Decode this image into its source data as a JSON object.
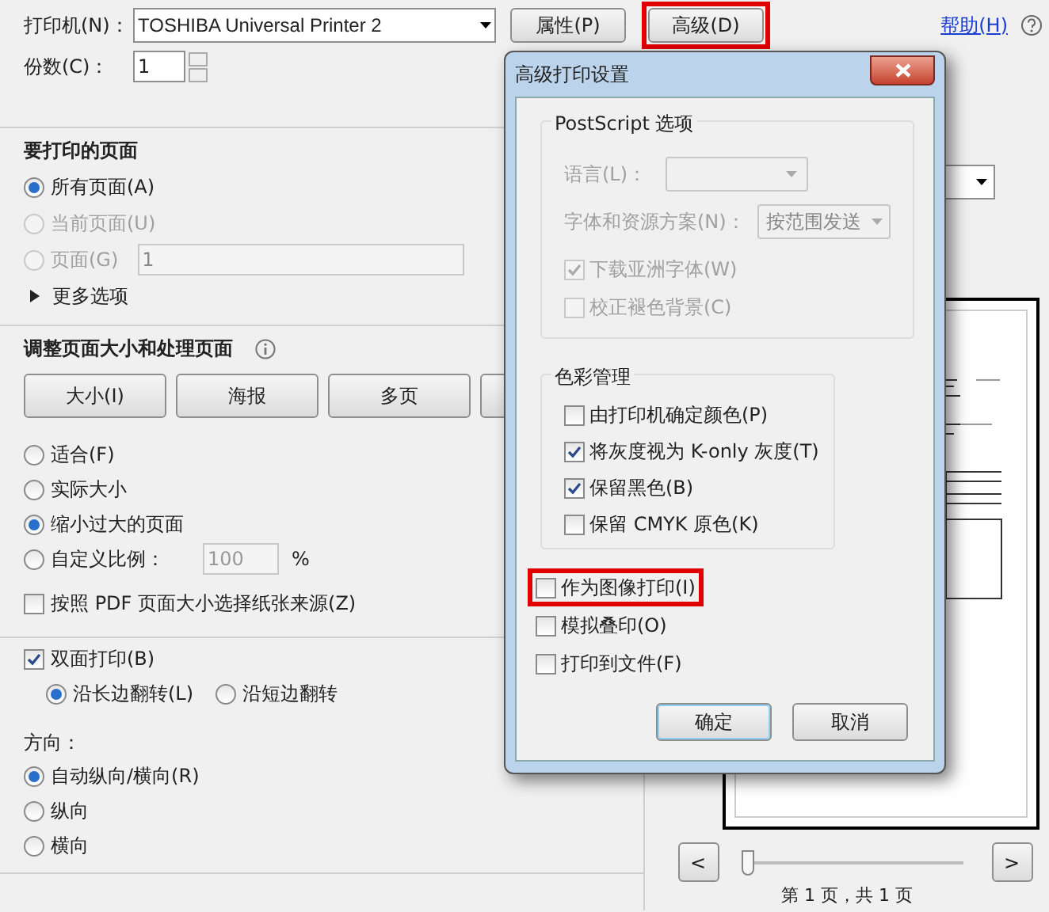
{
  "printer": {
    "label": "打印机(N)：",
    "value": "TOSHIBA Universal Printer 2"
  },
  "top_buttons": [
    {
      "label": "属性(P)",
      "highlighted": false
    },
    {
      "label": "高级(D)",
      "highlighted": true
    }
  ],
  "help_link": "帮助(H)",
  "copies": {
    "label": "份数(C)：",
    "value": "1"
  },
  "pages_section": {
    "title": "要打印的页面",
    "options": [
      {
        "label": "所有页面(A)",
        "selected": true,
        "disabled": false
      },
      {
        "label": "当前页面(U)",
        "selected": false,
        "disabled": true
      },
      {
        "label": "页面(G)",
        "selected": false,
        "disabled": true,
        "field_value": "1"
      }
    ],
    "more": "更多选项"
  },
  "sizing_section": {
    "title": "调整页面大小和处理页面",
    "buttons": [
      "大小(I)",
      "海报",
      "多页"
    ],
    "options": [
      {
        "label": "适合(F)",
        "selected": false
      },
      {
        "label": "实际大小",
        "selected": false
      },
      {
        "label": "缩小过大的页面",
        "selected": true
      },
      {
        "label": "自定义比例：",
        "selected": false,
        "field_value": "100",
        "unit": "%"
      }
    ],
    "paper_source": {
      "label": "按照 PDF 页面大小选择纸张来源(Z)",
      "checked": false
    }
  },
  "duplex": {
    "label": "双面打印(B)",
    "checked": true,
    "options": [
      {
        "label": "沿长边翻转(L)",
        "selected": true
      },
      {
        "label": "沿短边翻转",
        "selected": false
      }
    ]
  },
  "orientation": {
    "title": "方向：",
    "options": [
      {
        "label": "自动纵向/横向(R)",
        "selected": true
      },
      {
        "label": "纵向",
        "selected": false
      },
      {
        "label": "横向",
        "selected": false
      }
    ]
  },
  "preview": {
    "prev": "<",
    "next": ">",
    "slider": {
      "level": 0
    },
    "page_info": "第 1 页，共 1 页"
  },
  "dialog": {
    "title": "高级打印设置",
    "postscript": {
      "title": "PostScript 选项",
      "language_label": "语言(L)：",
      "font_label": "字体和资源方案(N)：",
      "font_value": "按范围发送",
      "checkboxes": [
        {
          "label": "下载亚洲字体(W)",
          "checked": true
        },
        {
          "label": "校正褪色背景(C)",
          "checked": false
        }
      ]
    },
    "color": {
      "title": "色彩管理",
      "checkboxes": [
        {
          "label": "由打印机确定颜色(P)",
          "checked": false
        },
        {
          "label": "将灰度视为 K-only 灰度(T)",
          "checked": true
        },
        {
          "label": "保留黑色(B)",
          "checked": true
        },
        {
          "label": "保留 CMYK 原色(K)",
          "checked": false
        }
      ]
    },
    "checkboxes": [
      {
        "label": "作为图像打印(I)",
        "checked": false,
        "highlighted": true
      },
      {
        "label": "模拟叠印(O)",
        "checked": false,
        "highlighted": false
      },
      {
        "label": "打印到文件(F)",
        "checked": false,
        "highlighted": false
      }
    ],
    "buttons": [
      {
        "label": "确定",
        "default": true
      },
      {
        "label": "取消",
        "default": false
      }
    ]
  }
}
